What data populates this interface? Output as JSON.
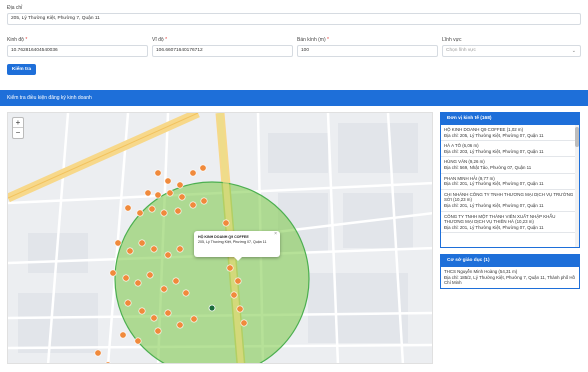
{
  "form": {
    "address_label": "Địa chỉ",
    "address_value": "205, Lý Thường Kiệt, Phường 7, Quận 11",
    "lng_label": "Kinh độ",
    "lng_value": "10.762816404540036",
    "lat_label": "Vĩ độ",
    "lat_value": "106.66071640176712",
    "radius_label": "Bán kính (m)",
    "radius_value": "100",
    "field_label": "Lĩnh vực",
    "field_placeholder": "Chọn lĩnh vực",
    "required_mark": "*",
    "check_button": "Kiểm tra"
  },
  "section_title": "Kiểm tra điều kiện đăng ký kinh doanh",
  "map": {
    "zoom_in": "+",
    "zoom_out": "−",
    "popup_title": "HỘ KINH DOANH Q9 COFFEE",
    "popup_address": "205, Lý Thường Kiệt, Phường 07, Quận 11",
    "popup_close": "×",
    "accent_color": "#1e6fd9",
    "circle_color": "#7ac943",
    "marker_color": "#f08a3c"
  },
  "panel1": {
    "title": "Đơn vị kinh tế (168)",
    "items": [
      {
        "name": "HỘ KINH DOANH Q9 COFFEE (1,02 m)",
        "addr": "Địa chỉ: 205, Lý Thường Kiệt, Phường 07, Quận 11"
      },
      {
        "name": "HÀ A TÔ (6,06 m)",
        "addr": "Địa chỉ: 203, Lý Thường Kiệt, Phường 07, Quận 11"
      },
      {
        "name": "HÙNG VĂN (9,26 m)",
        "addr": "Địa chỉ: 569, Nhật Tảo, Phường 07, Quận 11"
      },
      {
        "name": "PHAN MINH HẢI (9,77 m)",
        "addr": "Địa chỉ: 201, Lý Thường Kiệt, Phường 07, Quận 11"
      },
      {
        "name": "CHI NHÁNH CÔNG TY TNHH THƯƠNG MẠI DỊCH VỤ TRƯỜNG SỞI (10,23 m)",
        "addr": "Địa chỉ: 201, Lý Thường Kiệt, Phường 07, Quận 11"
      },
      {
        "name": "CÔNG TY TNHH MỘT THÀNH VIÊN XUẤT NHẬP KHẨU THƯƠNG MẠI DỊCH VỤ THIÊN HÀ (10,23 m)",
        "addr": "Địa chỉ: 201, Lý Thường Kiệt, Phường 07, Quận 11"
      }
    ]
  },
  "panel2": {
    "title": "Cơ sở giáo dục (1)",
    "items": [
      {
        "name": "THCS Nguyễn Minh Hoàng (54,31 m)",
        "addr": "Địa chỉ: 185/2, Lý Thường Kiệt, Phường 7, Quận 11, Thành phố Hồ Chí Minh"
      }
    ]
  }
}
